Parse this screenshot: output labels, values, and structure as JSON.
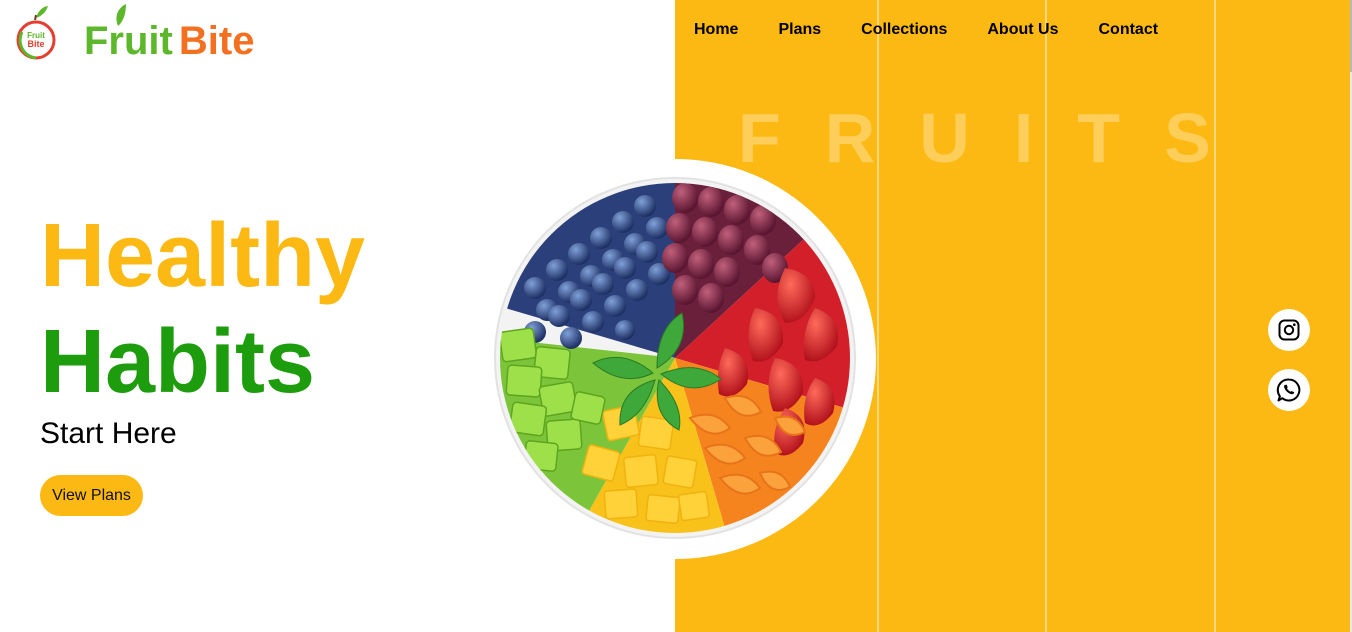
{
  "brand": {
    "name_part1": "Fruit",
    "name_part2": "Bite",
    "mark_line1": "Fruit",
    "mark_line2": "Bite"
  },
  "nav": [
    {
      "label": "Home"
    },
    {
      "label": "Plans"
    },
    {
      "label": "Collections"
    },
    {
      "label": "About Us"
    },
    {
      "label": "Contact"
    }
  ],
  "hero": {
    "title_line1": "Healthy",
    "title_line2": "Habits",
    "subtitle": "Start Here",
    "cta_label": "View Plans",
    "background_word": "FRUITS"
  },
  "bowl_image": {
    "contents": [
      "blueberries",
      "red grapes",
      "strawberries",
      "mandarin segments",
      "mango cubes",
      "green apple cubes",
      "mint leaves"
    ]
  },
  "social": [
    {
      "icon": "instagram-icon"
    },
    {
      "icon": "whatsapp-icon"
    }
  ],
  "colors": {
    "accent_yellow": "#fdb913",
    "accent_green": "#1d9d0d",
    "logo_green": "#5cb82a",
    "logo_orange": "#f37021"
  }
}
